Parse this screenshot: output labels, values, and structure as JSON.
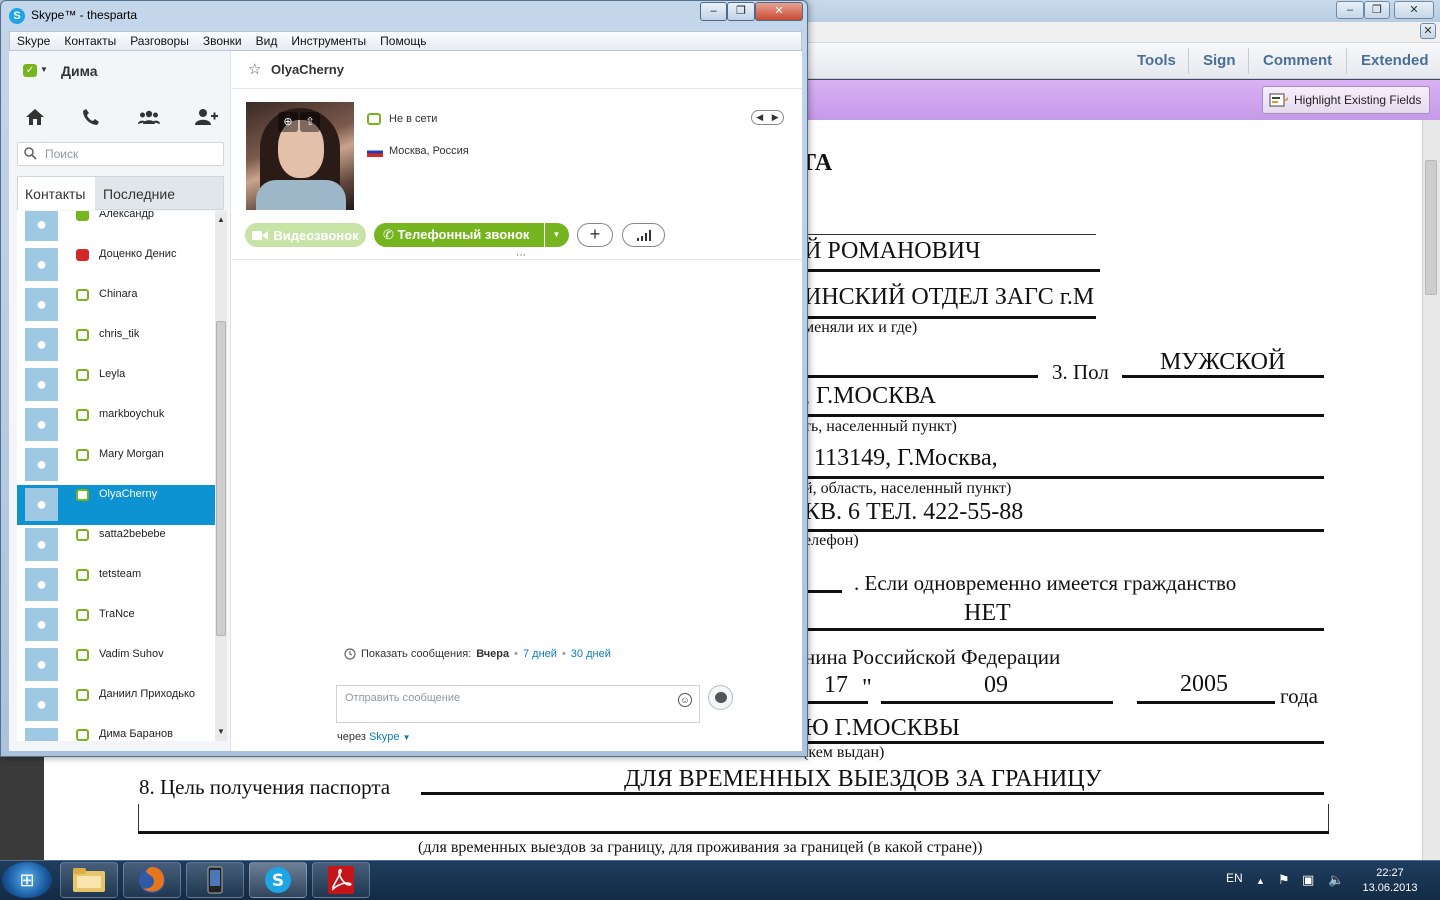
{
  "acrobat": {
    "tools": {
      "tools": "Tools",
      "sign": "Sign",
      "comment": "Comment",
      "extended": "Extended"
    },
    "highlight_fields": "Highlight Existing Fields",
    "doc": {
      "l1": "ТА",
      "l2": "Й РОМАНОВИЧ",
      "l3": "ИНСКИЙ ОТДЕЛ ЗАГС г.М",
      "l4": "меняли их и где)",
      "pol_label": "3. Пол",
      "pol_value": "МУЖСКОЙ",
      "city": ", Г.МОСКВА",
      "place_hint": "ть, населенный пункт)",
      "address": "113149, Г.Москва,",
      "region_hint": "й, область, населенный пункт)",
      "phone": "КВ. 6 ТЕЛ. 422-55-88",
      "phone_hint": "елефон)",
      "dual": ". Если одновременно имеется гражданство",
      "dual_value": "НЕТ",
      "citizen": "нина Российской Федерации",
      "day": "17",
      "quote": "\"",
      "month": "09",
      "year": "2005",
      "year_label": "года",
      "issuer": "Ю Г.МОСКВЫ",
      "issuer_hint": "(кем выдан)",
      "purpose_label": "8. Цель получения паспорта",
      "purpose_value": "ДЛЯ ВРЕМЕННЫХ ВЫЕЗДОВ ЗА ГРАНИЦУ",
      "purpose_hint": "(для временных выездов за границу, для проживания за границей (в какой стране))"
    }
  },
  "skype": {
    "title": "Skype™ - thesparta",
    "menu": [
      "Skype",
      "Контакты",
      "Разговоры",
      "Звонки",
      "Вид",
      "Инструменты",
      "Помощь"
    ],
    "me": "Дима",
    "search_placeholder": "Поиск",
    "tabs": {
      "contacts": "Контакты",
      "recent": "Последние"
    },
    "contacts": [
      {
        "name": "Александр",
        "status": "online"
      },
      {
        "name": "Доценко Денис",
        "status": "busy"
      },
      {
        "name": "Chinara",
        "status": "forward"
      },
      {
        "name": "chris_tik",
        "status": "offline"
      },
      {
        "name": "Leyla",
        "status": "forward"
      },
      {
        "name": "markboychuk",
        "status": "offline"
      },
      {
        "name": "Mary Morgan",
        "status": "offline"
      },
      {
        "name": "OlyaCherny",
        "status": "offline",
        "selected": true
      },
      {
        "name": "satta2bebebe",
        "status": "offline"
      },
      {
        "name": "tetsteam",
        "status": "offline"
      },
      {
        "name": "TraNce",
        "status": "offline"
      },
      {
        "name": "Vadim Suhov",
        "status": "offline"
      },
      {
        "name": "Даниил Приходько",
        "status": "offline"
      },
      {
        "name": "Дима Баранов",
        "status": "offline"
      }
    ],
    "conversation": {
      "name": "OlyaCherny",
      "status": "Не в сети",
      "location": "Москва, Россия",
      "video_btn": "Видеозвонок",
      "call_btn": "Телефонный звонок",
      "history_prefix": "Показать сообщения:",
      "history_yesterday": "Вчера",
      "history_7": "7 дней",
      "history_30": "30 дней",
      "message_placeholder": "Отправить сообщение",
      "via_prefix": "через",
      "via_service": "Skype"
    }
  },
  "taskbar": {
    "lang": "EN",
    "time": "22:27",
    "date": "13.06.2013"
  }
}
